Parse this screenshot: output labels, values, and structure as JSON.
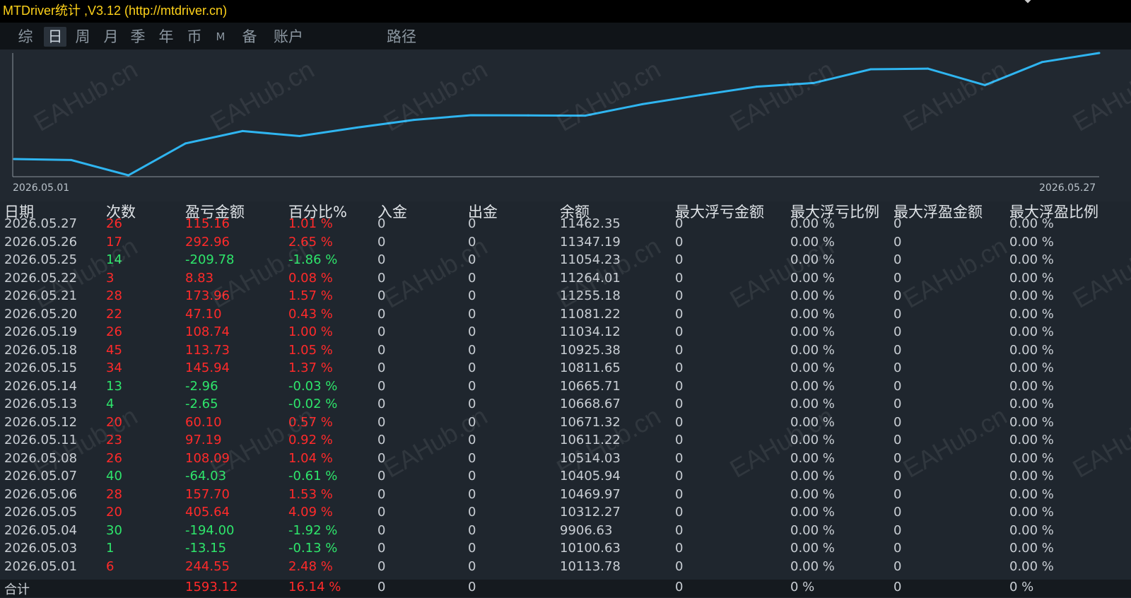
{
  "window": {
    "title": "MTDriver统计 ,V3.12 (http://mtdriver.cn)"
  },
  "tabs": [
    {
      "label": "综",
      "active": false
    },
    {
      "label": "日",
      "active": true
    },
    {
      "label": "周",
      "active": false
    },
    {
      "label": "月",
      "active": false
    },
    {
      "label": "季",
      "active": false
    },
    {
      "label": "年",
      "active": false
    },
    {
      "label": "币",
      "active": false
    },
    {
      "label": "M",
      "active": false
    },
    {
      "label": "备",
      "active": false
    },
    {
      "label": "账户",
      "active": false
    },
    {
      "label": "路径",
      "active": false
    }
  ],
  "watermark": "EAHub.cn",
  "chart_data": {
    "type": "line",
    "x": [
      "2026.05.01",
      "2026.05.03",
      "2026.05.04",
      "2026.05.05",
      "2026.05.06",
      "2026.05.07",
      "2026.05.08",
      "2026.05.11",
      "2026.05.12",
      "2026.05.13",
      "2026.05.14",
      "2026.05.15",
      "2026.05.18",
      "2026.05.19",
      "2026.05.20",
      "2026.05.21",
      "2026.05.22",
      "2026.05.25",
      "2026.05.26",
      "2026.05.27"
    ],
    "y": [
      10113.78,
      10100.63,
      9906.63,
      10312.27,
      10469.97,
      10405.94,
      10514.03,
      10611.22,
      10671.32,
      10668.67,
      10665.71,
      10811.65,
      10925.38,
      11034.12,
      11081.22,
      11255.18,
      11264.01,
      11054.23,
      11347.19,
      11462.35
    ],
    "x_start_label": "2026.05.01",
    "x_end_label": "2026.05.27",
    "line_color": "#2fb5f0",
    "axis_color": "#8a939c"
  },
  "table": {
    "headers": [
      "日期",
      "次数",
      "盈亏金额",
      "百分比%",
      "入金",
      "出金",
      "余额",
      "最大浮亏金额",
      "最大浮亏比例",
      "最大浮盈金额",
      "最大浮盈比例"
    ],
    "rows": [
      {
        "date": "2026.05.27",
        "count": "26",
        "pnl": "115.16",
        "pct": "1.01 %",
        "dep": "0",
        "wd": "0",
        "bal": "11462.35",
        "mfl": "0",
        "mflp": "0.00 %",
        "mfp": "0",
        "mfpp": "0.00 %",
        "sign": "pos"
      },
      {
        "date": "2026.05.26",
        "count": "17",
        "pnl": "292.96",
        "pct": "2.65 %",
        "dep": "0",
        "wd": "0",
        "bal": "11347.19",
        "mfl": "0",
        "mflp": "0.00 %",
        "mfp": "0",
        "mfpp": "0.00 %",
        "sign": "pos"
      },
      {
        "date": "2026.05.25",
        "count": "14",
        "pnl": "-209.78",
        "pct": "-1.86 %",
        "dep": "0",
        "wd": "0",
        "bal": "11054.23",
        "mfl": "0",
        "mflp": "0.00 %",
        "mfp": "0",
        "mfpp": "0.00 %",
        "sign": "neg"
      },
      {
        "date": "2026.05.22",
        "count": "3",
        "pnl": "8.83",
        "pct": "0.08 %",
        "dep": "0",
        "wd": "0",
        "bal": "11264.01",
        "mfl": "0",
        "mflp": "0.00 %",
        "mfp": "0",
        "mfpp": "0.00 %",
        "sign": "pos"
      },
      {
        "date": "2026.05.21",
        "count": "28",
        "pnl": "173.96",
        "pct": "1.57 %",
        "dep": "0",
        "wd": "0",
        "bal": "11255.18",
        "mfl": "0",
        "mflp": "0.00 %",
        "mfp": "0",
        "mfpp": "0.00 %",
        "sign": "pos"
      },
      {
        "date": "2026.05.20",
        "count": "22",
        "pnl": "47.10",
        "pct": "0.43 %",
        "dep": "0",
        "wd": "0",
        "bal": "11081.22",
        "mfl": "0",
        "mflp": "0.00 %",
        "mfp": "0",
        "mfpp": "0.00 %",
        "sign": "pos"
      },
      {
        "date": "2026.05.19",
        "count": "26",
        "pnl": "108.74",
        "pct": "1.00 %",
        "dep": "0",
        "wd": "0",
        "bal": "11034.12",
        "mfl": "0",
        "mflp": "0.00 %",
        "mfp": "0",
        "mfpp": "0.00 %",
        "sign": "pos"
      },
      {
        "date": "2026.05.18",
        "count": "45",
        "pnl": "113.73",
        "pct": "1.05 %",
        "dep": "0",
        "wd": "0",
        "bal": "10925.38",
        "mfl": "0",
        "mflp": "0.00 %",
        "mfp": "0",
        "mfpp": "0.00 %",
        "sign": "pos"
      },
      {
        "date": "2026.05.15",
        "count": "34",
        "pnl": "145.94",
        "pct": "1.37 %",
        "dep": "0",
        "wd": "0",
        "bal": "10811.65",
        "mfl": "0",
        "mflp": "0.00 %",
        "mfp": "0",
        "mfpp": "0.00 %",
        "sign": "pos"
      },
      {
        "date": "2026.05.14",
        "count": "13",
        "pnl": "-2.96",
        "pct": "-0.03 %",
        "dep": "0",
        "wd": "0",
        "bal": "10665.71",
        "mfl": "0",
        "mflp": "0.00 %",
        "mfp": "0",
        "mfpp": "0.00 %",
        "sign": "neg"
      },
      {
        "date": "2026.05.13",
        "count": "4",
        "pnl": "-2.65",
        "pct": "-0.02 %",
        "dep": "0",
        "wd": "0",
        "bal": "10668.67",
        "mfl": "0",
        "mflp": "0.00 %",
        "mfp": "0",
        "mfpp": "0.00 %",
        "sign": "neg"
      },
      {
        "date": "2026.05.12",
        "count": "20",
        "pnl": "60.10",
        "pct": "0.57 %",
        "dep": "0",
        "wd": "0",
        "bal": "10671.32",
        "mfl": "0",
        "mflp": "0.00 %",
        "mfp": "0",
        "mfpp": "0.00 %",
        "sign": "pos"
      },
      {
        "date": "2026.05.11",
        "count": "23",
        "pnl": "97.19",
        "pct": "0.92 %",
        "dep": "0",
        "wd": "0",
        "bal": "10611.22",
        "mfl": "0",
        "mflp": "0.00 %",
        "mfp": "0",
        "mfpp": "0.00 %",
        "sign": "pos"
      },
      {
        "date": "2026.05.08",
        "count": "26",
        "pnl": "108.09",
        "pct": "1.04 %",
        "dep": "0",
        "wd": "0",
        "bal": "10514.03",
        "mfl": "0",
        "mflp": "0.00 %",
        "mfp": "0",
        "mfpp": "0.00 %",
        "sign": "pos"
      },
      {
        "date": "2026.05.07",
        "count": "40",
        "pnl": "-64.03",
        "pct": "-0.61 %",
        "dep": "0",
        "wd": "0",
        "bal": "10405.94",
        "mfl": "0",
        "mflp": "0.00 %",
        "mfp": "0",
        "mfpp": "0.00 %",
        "sign": "neg"
      },
      {
        "date": "2026.05.06",
        "count": "28",
        "pnl": "157.70",
        "pct": "1.53 %",
        "dep": "0",
        "wd": "0",
        "bal": "10469.97",
        "mfl": "0",
        "mflp": "0.00 %",
        "mfp": "0",
        "mfpp": "0.00 %",
        "sign": "pos"
      },
      {
        "date": "2026.05.05",
        "count": "20",
        "pnl": "405.64",
        "pct": "4.09 %",
        "dep": "0",
        "wd": "0",
        "bal": "10312.27",
        "mfl": "0",
        "mflp": "0.00 %",
        "mfp": "0",
        "mfpp": "0.00 %",
        "sign": "pos"
      },
      {
        "date": "2026.05.04",
        "count": "30",
        "pnl": "-194.00",
        "pct": "-1.92 %",
        "dep": "0",
        "wd": "0",
        "bal": "9906.63",
        "mfl": "0",
        "mflp": "0.00 %",
        "mfp": "0",
        "mfpp": "0.00 %",
        "sign": "neg"
      },
      {
        "date": "2026.05.03",
        "count": "1",
        "pnl": "-13.15",
        "pct": "-0.13 %",
        "dep": "0",
        "wd": "0",
        "bal": "10100.63",
        "mfl": "0",
        "mflp": "0.00 %",
        "mfp": "0",
        "mfpp": "0.00 %",
        "sign": "neg"
      },
      {
        "date": "2026.05.01",
        "count": "6",
        "pnl": "244.55",
        "pct": "2.48 %",
        "dep": "0",
        "wd": "0",
        "bal": "10113.78",
        "mfl": "0",
        "mflp": "0.00 %",
        "mfp": "0",
        "mfpp": "0.00 %",
        "sign": "pos"
      }
    ],
    "total": {
      "label": "合计",
      "pnl": "1593.12",
      "pct": "16.14 %",
      "dep": "0",
      "wd": "0",
      "mfl": "0",
      "mflp": "0 %",
      "mfp": "0",
      "mfpp": "0 %"
    }
  }
}
